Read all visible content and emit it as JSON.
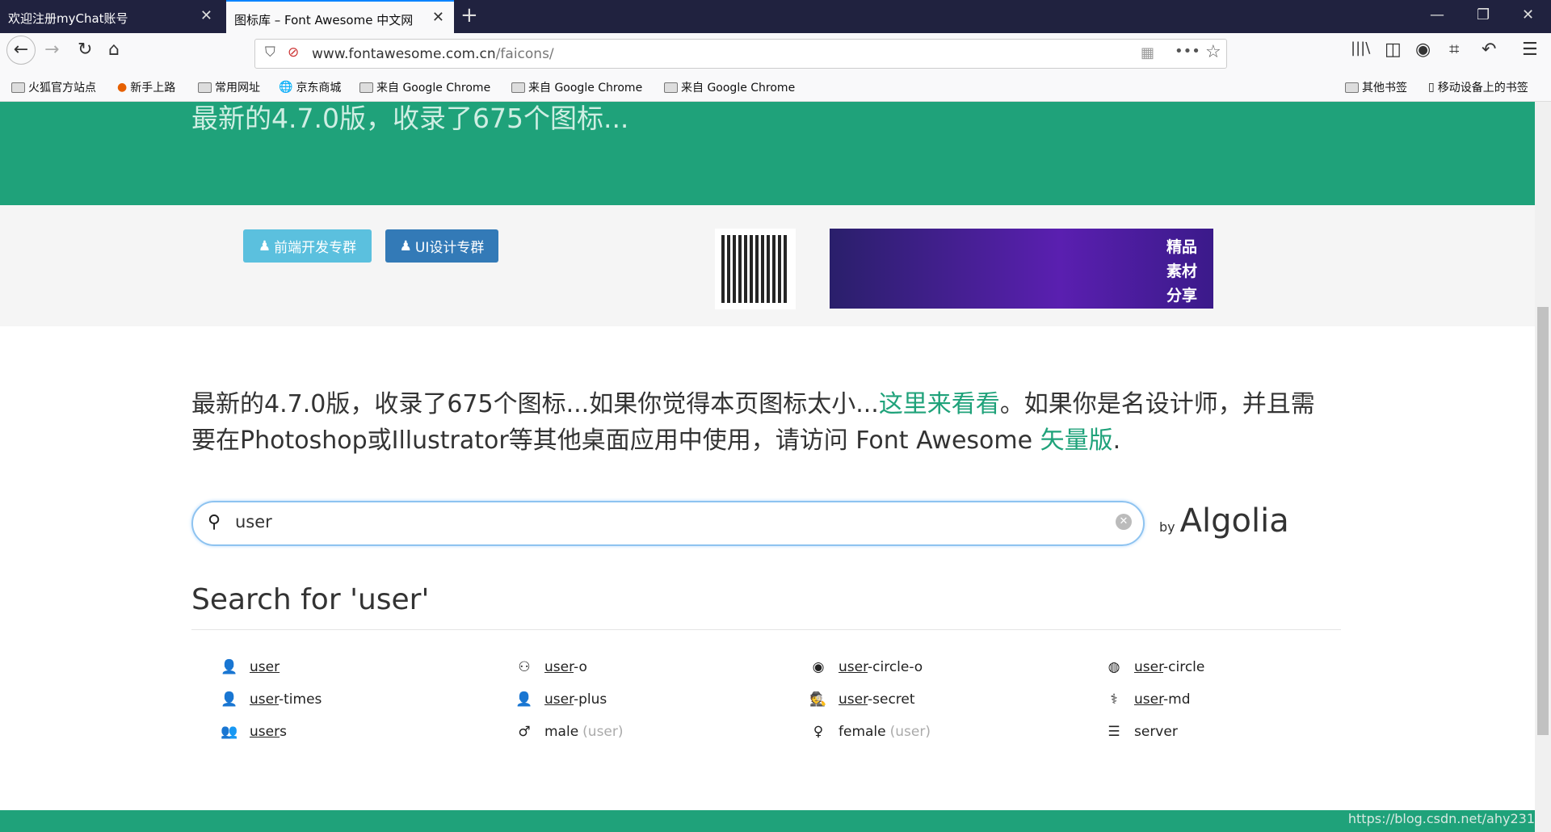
{
  "browser": {
    "tabs": [
      {
        "title": "欢迎注册myChat账号",
        "active": false
      },
      {
        "title": "图标库 – Font Awesome 中文网",
        "active": true
      }
    ],
    "url_host": "www.fontawesome.com.cn",
    "url_path": "/faicons/",
    "bookmarks": [
      "火狐官方站点",
      "新手上路",
      "常用网址",
      "京东商城",
      "来自 Google Chrome",
      "来自 Google Chrome",
      "来自 Google Chrome"
    ],
    "bookmarks_right": [
      "其他书签",
      "移动设备上的书签"
    ]
  },
  "page": {
    "header_text": "最新的4.7.0版，收录了675个图标...",
    "buttons": [
      "前端开发专群",
      "UI设计专群"
    ],
    "banner_text": "精品素材分享",
    "intro": {
      "p1": "最新的4.7.0版，收录了675个图标...如果你觉得本页图标太小...",
      "link1": "这里来看看",
      "p2": "。如果你是名设计师，并且需要在Photoshop或Illustrator等其他桌面应用中使用，请访问 Font Awesome ",
      "link2": "矢量版",
      "p3": "."
    },
    "search": {
      "value": "user"
    },
    "by": "by",
    "algolia": "Algolia",
    "heading": "Search for 'user'",
    "results": [
      {
        "icon": "user-icon",
        "glyph": "👤",
        "match": "user",
        "rest": "",
        "alias": ""
      },
      {
        "icon": "user-o-icon",
        "glyph": "⚇",
        "match": "user",
        "rest": "-o",
        "alias": ""
      },
      {
        "icon": "user-circle-o-icon",
        "glyph": "◉",
        "match": "user",
        "rest": "-circle-o",
        "alias": ""
      },
      {
        "icon": "user-circle-icon",
        "glyph": "◍",
        "match": "user",
        "rest": "-circle",
        "alias": ""
      },
      {
        "icon": "user-times-icon",
        "glyph": "👤",
        "match": "user",
        "rest": "-times",
        "alias": ""
      },
      {
        "icon": "user-plus-icon",
        "glyph": "👤",
        "match": "user",
        "rest": "-plus",
        "alias": ""
      },
      {
        "icon": "user-secret-icon",
        "glyph": "🕵",
        "match": "user",
        "rest": "-secret",
        "alias": ""
      },
      {
        "icon": "user-md-icon",
        "glyph": "⚕",
        "match": "user",
        "rest": "-md",
        "alias": ""
      },
      {
        "icon": "users-icon",
        "glyph": "👥",
        "match": "user",
        "rest": "s",
        "alias": ""
      },
      {
        "icon": "male-icon",
        "glyph": "♂",
        "match": "",
        "rest": "male",
        "alias": "(user)"
      },
      {
        "icon": "female-icon",
        "glyph": "♀",
        "match": "",
        "rest": "female",
        "alias": "(user)"
      },
      {
        "icon": "server-icon",
        "glyph": "☰",
        "match": "",
        "rest": "server",
        "alias": ""
      }
    ],
    "watermark": "https://blog.csdn.net/ahy231"
  },
  "colors": {
    "brand_green": "#1fa27a",
    "tab_bar": "#20223f",
    "btn1": "#5bc0de",
    "btn2": "#337ab7"
  }
}
